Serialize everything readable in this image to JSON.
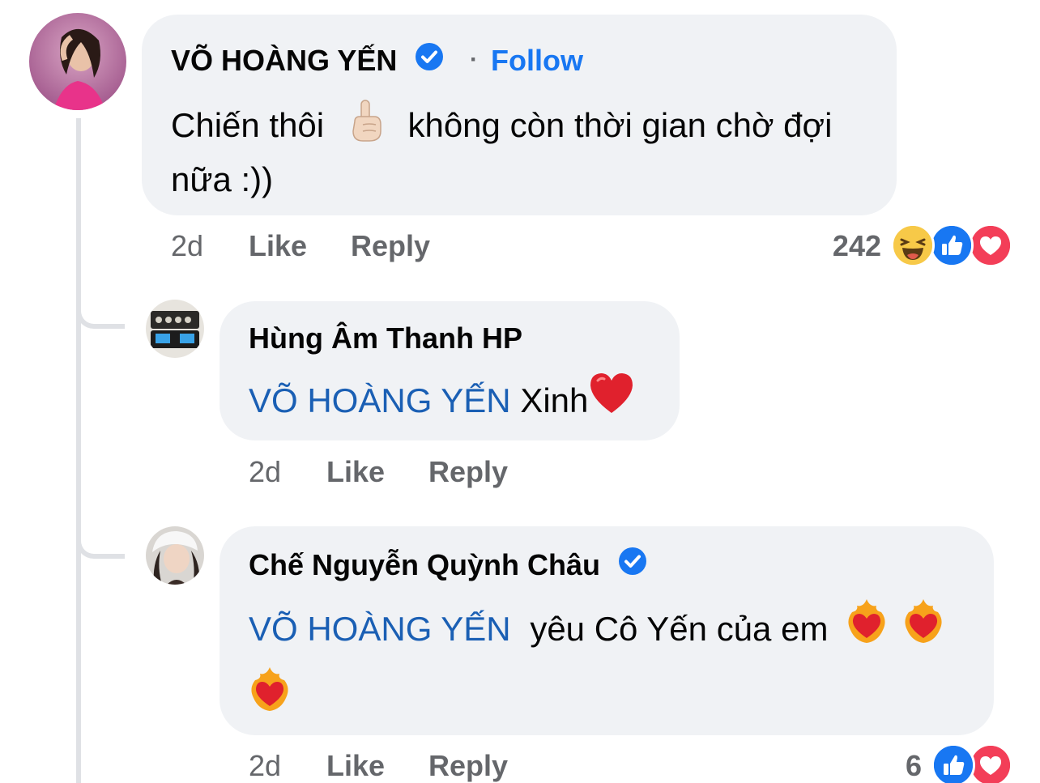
{
  "comments": [
    {
      "author": "VÕ HOÀNG YẾN",
      "verified": true,
      "follow_label": "Follow",
      "separator": "·",
      "text_part1": "Chiến thôi",
      "emoji_1": "pointing-up-hand",
      "text_part2": "không còn thời gian chờ đợi",
      "text_line2": "nữa :))",
      "time": "2d",
      "like_label": "Like",
      "reply_label": "Reply",
      "reaction_count": "242",
      "reactions": [
        "haha",
        "like",
        "love"
      ]
    },
    {
      "author": "Hùng Âm Thanh HP",
      "verified": false,
      "mention": "VÕ HOÀNG YẾN",
      "text": "Xinh",
      "emoji": "red-heart",
      "time": "2d",
      "like_label": "Like",
      "reply_label": "Reply"
    },
    {
      "author": "Chế Nguyễn Quỳnh Châu",
      "verified": true,
      "mention": "VÕ HOÀNG YẾN",
      "text": "yêu Cô Yến của em",
      "emojis": [
        "heart-on-fire",
        "heart-on-fire",
        "heart-on-fire"
      ],
      "time": "2d",
      "like_label": "Like",
      "reply_label": "Reply",
      "reaction_count": "6",
      "reactions": [
        "like",
        "love"
      ]
    }
  ],
  "colors": {
    "bubble": "#f0f2f5",
    "link_blue": "#1877f2",
    "mention_blue": "#1a5fb4",
    "meta_gray": "#65676b",
    "thread_line": "#dfe1e5"
  }
}
